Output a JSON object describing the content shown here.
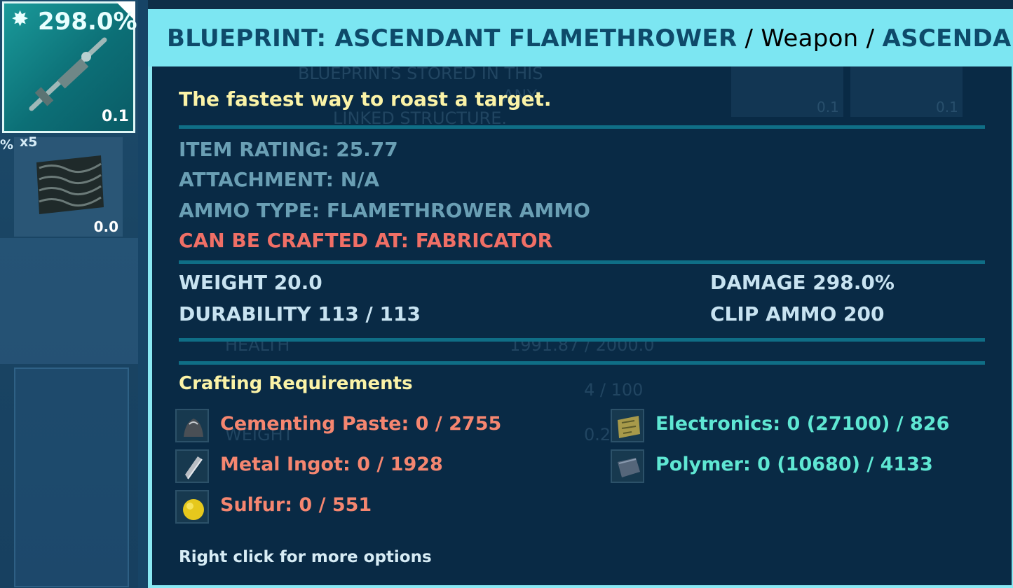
{
  "inventory": {
    "slot1": {
      "quality_pct": "298.0%",
      "weight": "0.1",
      "icon": "flamethrower-icon"
    },
    "slot2": {
      "count": "x5",
      "weight": "0.0",
      "icon": "chitin-icon"
    },
    "edge_pct": "%"
  },
  "tooltip": {
    "title_name": "BLUEPRINT: ASCENDANT FLAMETHROWER",
    "title_sep1": " / ",
    "title_type": "Weapon",
    "title_sep2": " / ",
    "title_quality": "ASCENDANT",
    "description": "The fastest way to roast a target.",
    "item_rating": "ITEM RATING: 25.77",
    "attachment": "ATTACHMENT: N/A",
    "ammo_type": "AMMO TYPE: FLAMETHROWER AMMO",
    "crafted_at": "CAN BE CRAFTED AT: FABRICATOR",
    "weight": "WEIGHT 20.0",
    "durability": "DURABILITY 113 / 113",
    "damage": "DAMAGE 298.0%",
    "clip_ammo": "CLIP AMMO 200",
    "crafting_title": "Crafting Requirements",
    "requirements": [
      {
        "label": "Cementing Paste: 0 / 2755",
        "icon": "cementing-paste-icon"
      },
      {
        "label": "Metal Ingot: 0 / 1928",
        "icon": "metal-ingot-icon"
      },
      {
        "label": "Sulfur: 0 / 551",
        "icon": "sulfur-icon"
      },
      {
        "label": "Electronics: 0 (27100) / 826",
        "icon": "electronics-icon"
      },
      {
        "label": "Polymer: 0 (10680) / 4133",
        "icon": "polymer-icon"
      }
    ],
    "hint": "Right click for more options"
  },
  "background_text": {
    "blueprints_line1": "BLUEPRINTS STORED IN THIS",
    "blueprints_line2": "ANY",
    "blueprints_line3": "LINKED STRUCTURE.",
    "health_label": "HEALTH",
    "health_value": "1991.87 / 2000.0",
    "stamina_value": "4 / 100",
    "weight_label": "WEIGHT",
    "weight_value": "0.2",
    "slot_weight_a": "0.1",
    "slot_weight_b": "0.1"
  },
  "colors": {
    "title_bar": "#7ce6f2",
    "panel_bg": "#092a45",
    "requirement_missing": "#f58670",
    "requirement_owned": "#5fe7d3",
    "description": "#fbf3a7"
  }
}
